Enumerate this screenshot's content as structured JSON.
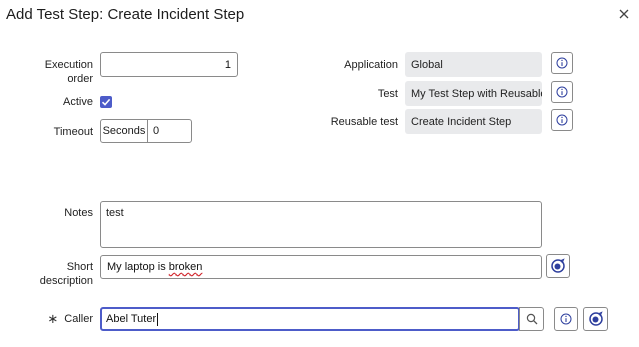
{
  "dialog": {
    "title": "Add Test Step: Create Incident Step"
  },
  "form": {
    "execution_order": {
      "label_line1": "Execution",
      "label_line2": "order",
      "value": "1"
    },
    "active": {
      "label": "Active",
      "checked": true
    },
    "timeout": {
      "label": "Timeout",
      "unit": "Seconds",
      "value": "0"
    },
    "application": {
      "label": "Application",
      "value": "Global"
    },
    "test": {
      "label": "Test",
      "value": "My Test Step with Reusable"
    },
    "reusable_test": {
      "label": "Reusable test",
      "value": "Create Incident Step"
    },
    "notes": {
      "label": "Notes",
      "value": "test"
    },
    "short_description": {
      "label_line1": "Short",
      "label_line2": "description",
      "value_prefix": "My laptop is ",
      "value_misspelled": "broken"
    },
    "caller": {
      "required_mark": "∗",
      "label": "Caller",
      "value": "Abel Tuter"
    }
  },
  "icons": {
    "close": "close-icon",
    "info": "info-icon",
    "search": "search-icon",
    "suggest": "suggestion-icon"
  },
  "colors": {
    "accent": "#4d5cc9",
    "readonly_bg": "#e9eaec",
    "focus_border": "#4d5cc9",
    "icon_blue": "#2e3f9e"
  }
}
